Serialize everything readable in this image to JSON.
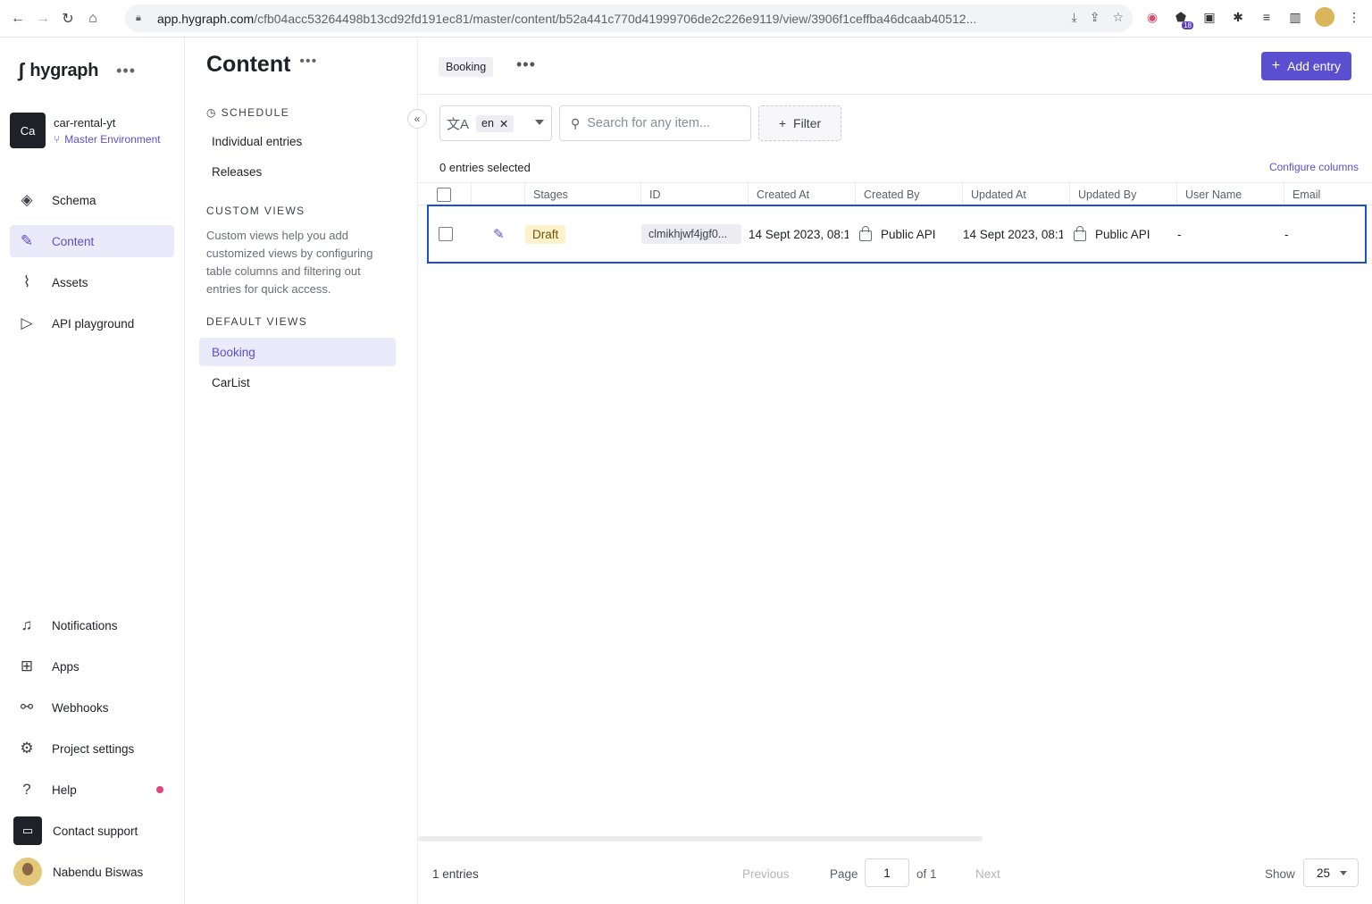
{
  "browser": {
    "url_host": "app.hygraph.com",
    "url_path": "/cfb04acc53264498b13cd92fd191ec81/master/content/b52a441c770d41999706de2c226e9119/view/3906f1ceffba46dcaab40512...",
    "ext_badge": "18"
  },
  "brand": {
    "name": "hygraph"
  },
  "project": {
    "initials": "Ca",
    "name": "car-rental-yt",
    "environment": "Master Environment"
  },
  "nav": {
    "items": [
      {
        "label": "Schema"
      },
      {
        "label": "Content"
      },
      {
        "label": "Assets"
      },
      {
        "label": "API playground"
      }
    ],
    "bottom": [
      {
        "label": "Notifications"
      },
      {
        "label": "Apps"
      },
      {
        "label": "Webhooks"
      },
      {
        "label": "Project settings"
      },
      {
        "label": "Help"
      },
      {
        "label": "Contact support"
      },
      {
        "label": "Nabendu Biswas"
      }
    ]
  },
  "panel": {
    "title": "Content",
    "schedule_heading": "SCHEDULE",
    "schedule_items": [
      "Individual entries",
      "Releases"
    ],
    "custom_heading": "CUSTOM VIEWS",
    "custom_desc": "Custom views help you add customized views by configuring table columns and filtering out entries for quick access.",
    "default_heading": "DEFAULT VIEWS",
    "default_items": [
      "Booking",
      "CarList"
    ]
  },
  "main": {
    "view_name": "Booking",
    "add_button": "Add entry",
    "locale": "en",
    "search_placeholder": "Search for any item...",
    "filter_label": "Filter",
    "selected_text": "0 entries selected",
    "configure_columns": "Configure columns",
    "columns": [
      "Stages",
      "ID",
      "Created At",
      "Created By",
      "Updated At",
      "Updated By",
      "User Name",
      "Email"
    ],
    "rows": [
      {
        "stage": "Draft",
        "id": "clmikhjwf4jgf0...",
        "created_at": "14 Sept 2023, 08:1",
        "created_by": "Public API",
        "updated_at": "14 Sept 2023, 08:1",
        "updated_by": "Public API",
        "user_name": "-",
        "email": "-"
      }
    ]
  },
  "footer": {
    "count": "1 entries",
    "previous": "Previous",
    "page_label": "Page",
    "page_value": "1",
    "of_label": "of 1",
    "next": "Next",
    "show_label": "Show",
    "page_size": "25"
  },
  "colors": {
    "accent": "#5a4fcf",
    "selection_outline": "#1a4fd1",
    "draft_bg": "#fdf2cc"
  }
}
